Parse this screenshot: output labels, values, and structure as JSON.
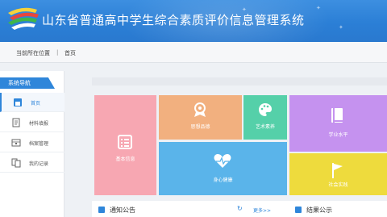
{
  "header": {
    "title": "山东省普通高中学生综合素质评价信息管理系统",
    "logo": "colorful-swoosh-logo"
  },
  "location": {
    "label": "当前所在位置",
    "separator": "|",
    "home": "首页"
  },
  "sidebar": {
    "heading": "系统导航",
    "items": [
      {
        "label": "首页",
        "icon": "home-icon"
      },
      {
        "label": "材料填报",
        "icon": "document-icon"
      },
      {
        "label": "档案管理",
        "icon": "archive-icon"
      },
      {
        "label": "我的记录",
        "icon": "record-icon"
      }
    ]
  },
  "tiles": {
    "basic": {
      "label": "基本信息",
      "icon": "info-list-icon",
      "color": "#f7a7b2"
    },
    "moral": {
      "label": "思想品德",
      "icon": "medal-icon",
      "color": "#f2b07f"
    },
    "art": {
      "label": "艺术素养",
      "icon": "palette-icon",
      "color": "#55d0a9"
    },
    "health": {
      "label": "身心健康",
      "icon": "heartbeat-icon",
      "color": "#5ab4ea"
    },
    "study": {
      "label": "学业水平",
      "icon": "book-icon",
      "color": "#c592ef"
    },
    "social": {
      "label": "社会实践",
      "icon": "flag-icon",
      "color": "#eedb3d"
    }
  },
  "bottom": {
    "notice": "通知公告",
    "more": "更多>>",
    "result": "结果公示"
  },
  "colors": {
    "header": "#2b7fd6",
    "accent": "#2f86da"
  }
}
